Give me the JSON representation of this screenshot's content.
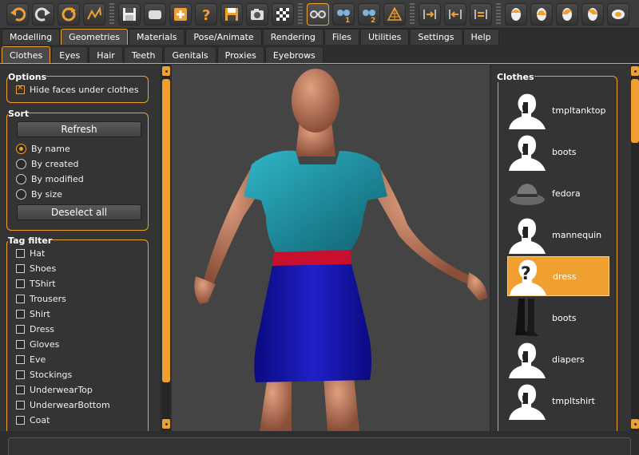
{
  "toolbar": {
    "groups": [
      [
        "undo-icon",
        "redo-icon",
        "reset-icon",
        "smooth-icon"
      ],
      [
        "save-icon",
        "load-icon",
        "export-icon",
        "help-icon",
        "save-as-icon",
        "screenshot-icon",
        "checker-icon"
      ],
      [
        "wireframe-glasses-icon",
        "pose-1-icon",
        "pose-2-icon",
        "grid-globe-icon"
      ],
      [
        "front-view-icon",
        "back-view-icon",
        "side-view-icon"
      ],
      [
        "head-front-icon",
        "head-back-icon",
        "head-left-icon",
        "head-right-icon",
        "head-top-icon"
      ]
    ]
  },
  "main_tabs": [
    "Modelling",
    "Geometries",
    "Materials",
    "Pose/Animate",
    "Rendering",
    "Files",
    "Utilities",
    "Settings",
    "Help"
  ],
  "main_tab_active": 1,
  "sub_tabs": [
    "Clothes",
    "Eyes",
    "Hair",
    "Teeth",
    "Genitals",
    "Proxies",
    "Eyebrows"
  ],
  "sub_tab_active": 0,
  "options": {
    "title": "Options",
    "hide_faces_label": "Hide faces under clothes",
    "hide_faces_checked": true
  },
  "sort": {
    "title": "Sort",
    "refresh_label": "Refresh",
    "options": [
      "By name",
      "By created",
      "By modified",
      "By size"
    ],
    "selected": 0,
    "deselect_label": "Deselect all"
  },
  "tag_filter": {
    "title": "Tag filter",
    "tags": [
      "Hat",
      "Shoes",
      "TShirt",
      "Trousers",
      "Shirt",
      "Dress",
      "Gloves",
      "Eve",
      "Stockings",
      "UnderwearTop",
      "UnderwearBottom",
      "Coat"
    ]
  },
  "clothes": {
    "title": "Clothes",
    "items": [
      {
        "label": "tmpltanktop",
        "thumb": "notfound"
      },
      {
        "label": "boots",
        "thumb": "notfound"
      },
      {
        "label": "fedora",
        "thumb": "fedora"
      },
      {
        "label": "mannequin",
        "thumb": "notfound"
      },
      {
        "label": "dress",
        "thumb": "notfound-question"
      },
      {
        "label": "boots",
        "thumb": "boots-black"
      },
      {
        "label": "diapers",
        "thumb": "notfound"
      },
      {
        "label": "tmpltshirt",
        "thumb": "notfound"
      }
    ],
    "selected": 4
  },
  "colors": {
    "accent": "#f0a030",
    "shirt": "#1a8ea0",
    "belt": "#c8102e",
    "skirt": "#1a1ab0",
    "skin": "#b5765a"
  }
}
